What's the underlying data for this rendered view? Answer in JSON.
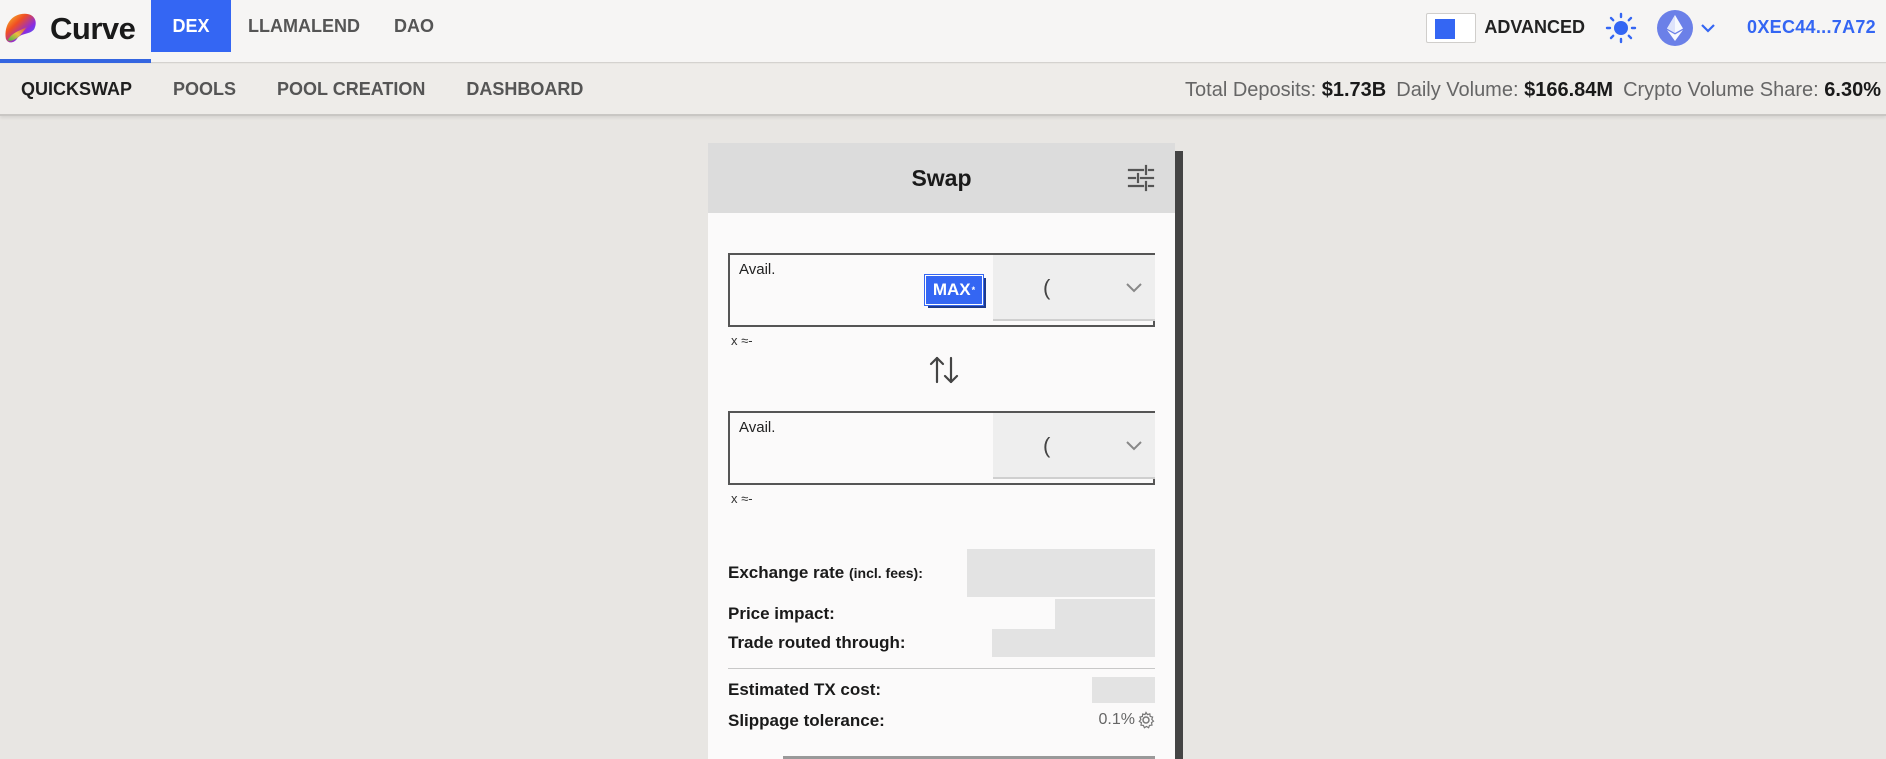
{
  "app": {
    "logo_text": "Curve"
  },
  "main_nav": [
    {
      "label": "DEX",
      "active": true
    },
    {
      "label": "LLAMALEND",
      "active": false
    },
    {
      "label": "DAO",
      "active": false
    }
  ],
  "topbar": {
    "advanced_label": "ADVANCED",
    "advanced_enabled": true,
    "wallet_address": "0XEC44...7A72",
    "network_icon": "ethereum-icon",
    "theme_icon": "sun-icon"
  },
  "sub_nav": [
    {
      "label": "QUICKSWAP",
      "active": true
    },
    {
      "label": "POOLS",
      "active": false
    },
    {
      "label": "POOL CREATION",
      "active": false
    },
    {
      "label": "DASHBOARD",
      "active": false
    }
  ],
  "stats": {
    "total_deposits_label": "Total Deposits:",
    "total_deposits_value": "$1.73B",
    "daily_volume_label": "Daily Volume:",
    "daily_volume_value": "$166.84M",
    "crypto_share_label": "Crypto Volume Share:",
    "crypto_share_value": "6.30%"
  },
  "swap": {
    "title": "Swap",
    "from": {
      "avail_label": "Avail.",
      "max_label": "MAX",
      "max_sup": "*",
      "token_text": "(",
      "usd_text": "x ≈-"
    },
    "to": {
      "avail_label": "Avail.",
      "token_text": "(",
      "usd_text": "x ≈-"
    },
    "details": {
      "exchange_rate_label": "Exchange rate",
      "exchange_rate_suffix": "(incl. fees):",
      "price_impact_label": "Price impact:",
      "trade_routed_label": "Trade routed through:",
      "tx_cost_label": "Estimated TX cost:",
      "slippage_label": "Slippage tolerance:",
      "slippage_value": "0.1%"
    }
  },
  "colors": {
    "accent": "#3466f3",
    "background": "#e8e6e3",
    "card": "#fbfafa"
  }
}
